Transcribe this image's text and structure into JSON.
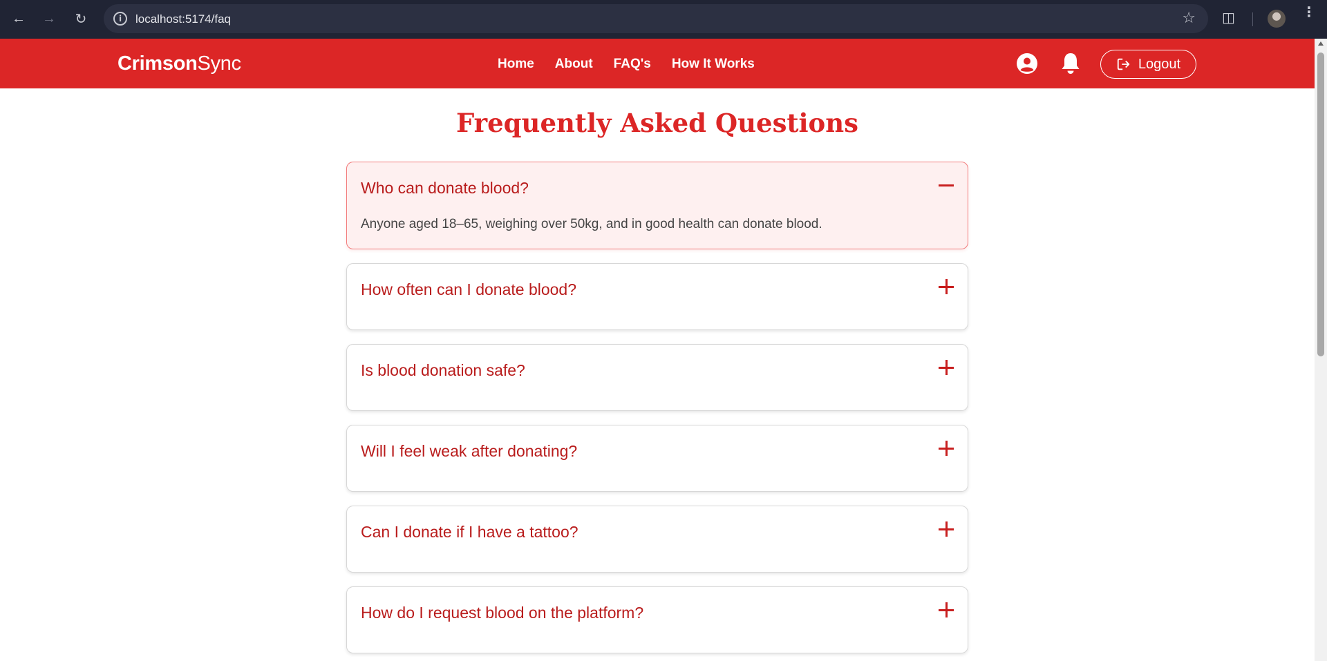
{
  "browser": {
    "url": "localhost:5174/faq"
  },
  "header": {
    "brand_bold": "Crimson",
    "brand_light": "Sync",
    "nav": [
      {
        "label": "Home"
      },
      {
        "label": "About"
      },
      {
        "label": "FAQ's"
      },
      {
        "label": "How It Works"
      }
    ],
    "logout_label": "Logout"
  },
  "main": {
    "title": "Frequently Asked Questions",
    "faqs": [
      {
        "question": "Who can donate blood?",
        "answer": "Anyone aged 18–65, weighing over 50kg, and in good health can donate blood.",
        "expanded": true
      },
      {
        "question": "How often can I donate blood?",
        "expanded": false
      },
      {
        "question": "Is blood donation safe?",
        "expanded": false
      },
      {
        "question": "Will I feel weak after donating?",
        "expanded": false
      },
      {
        "question": "Can I donate if I have a tattoo?",
        "expanded": false
      },
      {
        "question": "How do I request blood on the platform?",
        "expanded": false
      }
    ]
  },
  "colors": {
    "brand": "#dc2626",
    "question_text": "#b91c1c",
    "expanded_bg": "#fef0f0"
  }
}
